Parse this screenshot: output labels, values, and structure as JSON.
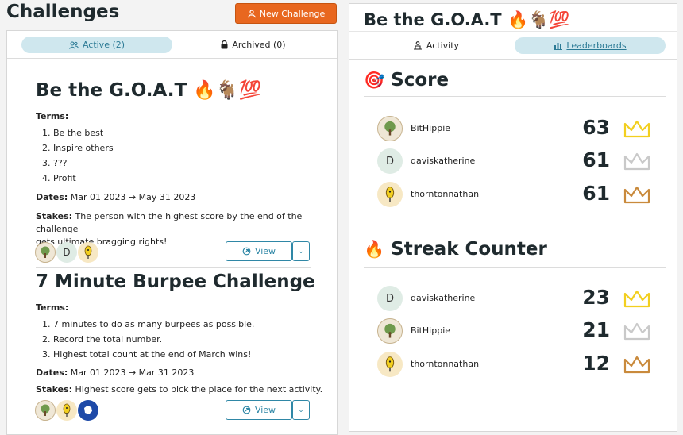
{
  "left": {
    "title": "Challenges",
    "new_button": "New Challenge",
    "tabs": [
      {
        "label": "Active (2)",
        "icon": "people-icon"
      },
      {
        "label": "Archived (0)",
        "icon": "lock-icon"
      }
    ],
    "challenges": [
      {
        "title": "Be the G.O.A.T 🔥🐐💯",
        "terms_label": "Terms:",
        "terms": [
          "Be the best",
          "Inspire others",
          "???",
          "Profit"
        ],
        "dates_label": "Dates:",
        "dates": "Mar 01 2023 → May 31 2023",
        "stakes_label": "Stakes:",
        "stakes_line1": "The person with the highest score by the end of the challenge",
        "stakes_line2": "gets ultimate bragging rights!",
        "view_label": "View"
      },
      {
        "title": "7 Minute Burpee Challenge",
        "terms_label": "Terms:",
        "terms": [
          "7 minutes to do as many burpees as possible.",
          "Record the total number.",
          "Highest total count at the end of March wins!"
        ],
        "dates_label": "Dates:",
        "dates": "Mar 01 2023 → Mar 31 2023",
        "stakes_label": "Stakes:",
        "stakes_line1": "Highest score gets to pick the place for the next activity.",
        "view_label": "View"
      }
    ],
    "avatar_letter": "D"
  },
  "right": {
    "title": "Be the G.O.A.T 🔥🐐💯",
    "tabs": [
      {
        "label": "Activity",
        "icon": "activity-icon"
      },
      {
        "label": "Leaderboards",
        "icon": "bar-chart-icon"
      }
    ],
    "score_section": {
      "emoji": "🎯",
      "title": "Score",
      "rows": [
        {
          "name": "BitHippie",
          "score": "63",
          "crown": "gold"
        },
        {
          "name": "daviskatherine",
          "score": "61",
          "crown": "silver"
        },
        {
          "name": "thorntonnathan",
          "score": "61",
          "crown": "bronze"
        }
      ]
    },
    "streak_section": {
      "emoji": "🔥",
      "title": "Streak Counter",
      "rows": [
        {
          "name": "daviskatherine",
          "score": "23",
          "crown": "gold"
        },
        {
          "name": "BitHippie",
          "score": "21",
          "crown": "silver"
        },
        {
          "name": "thorntonnathan",
          "score": "12",
          "crown": "bronze"
        }
      ]
    },
    "avatar_letter": "D"
  },
  "colors": {
    "accent_orange": "#e8671f",
    "accent_teal": "#2f87a6",
    "tab_active_bg": "#cfe7ee",
    "crown_gold": "#f2cf1f",
    "crown_silver": "#c9c9c9",
    "crown_bronze": "#c98a3c"
  }
}
